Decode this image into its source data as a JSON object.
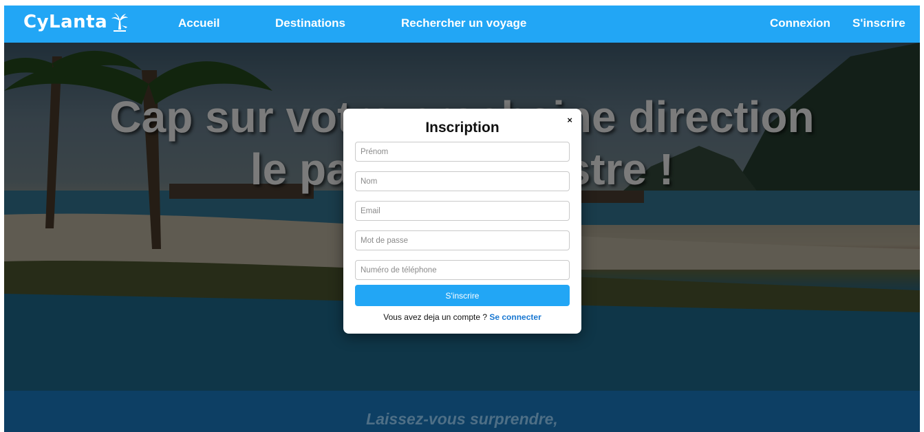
{
  "navbar": {
    "logo_text": "CyLanta",
    "links": [
      "Accueil",
      "Destinations",
      "Rechercher un voyage"
    ],
    "connexion": "Connexion",
    "inscrire": "S'inscrire"
  },
  "hero": {
    "title_line1": "Cap sur votre prochaine direction",
    "title_line2": "le paradis terrestre !"
  },
  "section": {
    "tagline": "Laissez-vous surprendre,"
  },
  "modal": {
    "title": "Inscription",
    "close": "×",
    "fields": {
      "prenom": "Prénom",
      "nom": "Nom",
      "email": "Email",
      "password": "Mot de passe",
      "phone": "Numéro de téléphone"
    },
    "submit": "S'inscrire",
    "footer_text": "Vous avez deja un compte ?",
    "login_link": "Se connecter"
  },
  "colors": {
    "accent": "#22a6f5",
    "band": "#0d3f64",
    "link": "#1877d1"
  }
}
